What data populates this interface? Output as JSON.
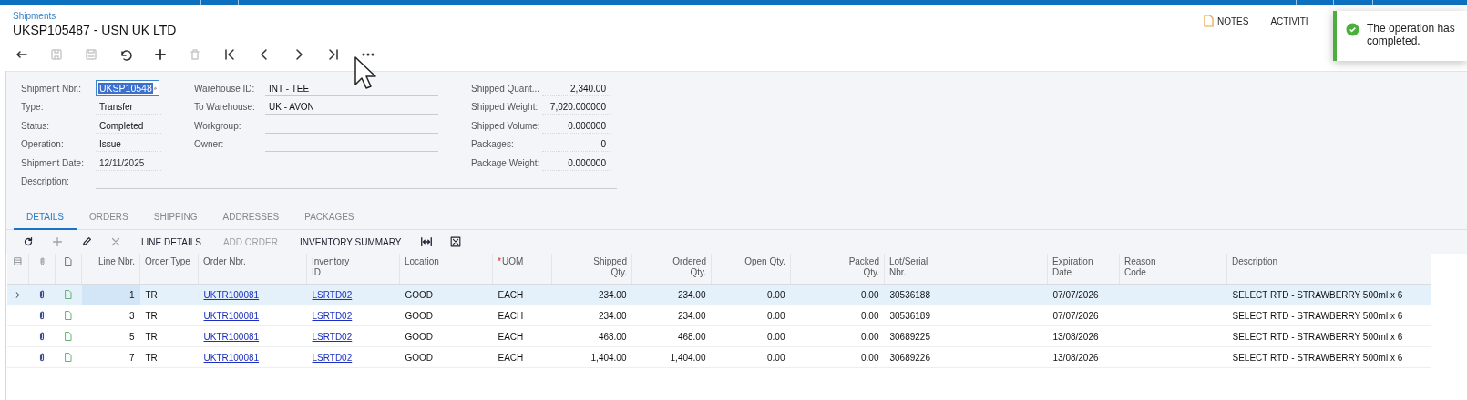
{
  "breadcrumb": "Shipments",
  "title": "UKSP105487 - USN UK LTD",
  "toolbar": [
    {
      "kind": "back",
      "disabled": false
    },
    {
      "kind": "save-close",
      "disabled": true
    },
    {
      "kind": "save",
      "disabled": true
    },
    {
      "kind": "undo",
      "disabled": false
    },
    {
      "kind": "add",
      "disabled": false
    },
    {
      "kind": "delete",
      "disabled": true
    },
    {
      "kind": "first",
      "disabled": false
    },
    {
      "kind": "prev",
      "disabled": false
    },
    {
      "kind": "next",
      "disabled": false
    },
    {
      "kind": "last",
      "disabled": false
    },
    {
      "kind": "more",
      "disabled": false
    }
  ],
  "header_links": [
    {
      "label": "NOTES",
      "kind": "note"
    },
    {
      "label": "ACTIVITI",
      "kind": "plain"
    }
  ],
  "toast": {
    "message": "The operation has completed.",
    "kind": "success"
  },
  "form": {
    "columns": [
      [
        {
          "label": "Shipment Nbr.:",
          "value": "UKSP10548",
          "kind": "search"
        },
        {
          "label": "Type:",
          "value": "Transfer",
          "kind": "text"
        },
        {
          "label": "Status:",
          "value": "Completed",
          "kind": "text"
        },
        {
          "label": "Operation:",
          "value": "Issue",
          "kind": "text"
        },
        {
          "label": "Shipment Date:",
          "value": "12/11/2025",
          "kind": "date"
        },
        {
          "label": "Description:",
          "kind": "wide"
        }
      ],
      [
        {
          "label": "Warehouse ID:",
          "value": "INT - TEE",
          "kind": "text"
        },
        {
          "label": "To Warehouse:",
          "value": "UK - AVON",
          "kind": "text"
        },
        {
          "label": "Workgroup:",
          "kind": "text"
        },
        {
          "label": "Owner:",
          "kind": "text"
        }
      ],
      [
        {
          "label": "Shipped Quant...",
          "value": "2,340.00",
          "kind": "number"
        },
        {
          "label": "Shipped Weight:",
          "value": "7,020.000000",
          "kind": "number"
        },
        {
          "label": "Shipped Volume:",
          "value": "0.000000",
          "kind": "number"
        },
        {
          "label": "Packages:",
          "value": "0",
          "kind": "number"
        },
        {
          "label": "Package Weight:",
          "value": "0.000000",
          "kind": "number"
        }
      ]
    ]
  },
  "tabs": [
    {
      "label": "DETAILS",
      "selected": true
    },
    {
      "label": "ORDERS",
      "selected": false
    },
    {
      "label": "SHIPPING",
      "selected": false
    },
    {
      "label": "ADDRESSES",
      "selected": false
    },
    {
      "label": "PACKAGES",
      "selected": false
    }
  ],
  "grid_toolbar": [
    {
      "kind": "refresh",
      "disabled": false
    },
    {
      "kind": "add",
      "disabled": true
    },
    {
      "kind": "edit",
      "disabled": false
    },
    {
      "kind": "delete",
      "disabled": true
    },
    {
      "kind": "text",
      "label": "LINE DETAILS",
      "disabled": false
    },
    {
      "kind": "text",
      "label": "ADD ORDER",
      "disabled": true
    },
    {
      "kind": "text",
      "label": "INVENTORY SUMMARY",
      "disabled": false
    },
    {
      "kind": "fit",
      "disabled": false
    },
    {
      "kind": "excel",
      "disabled": false
    }
  ],
  "grid": {
    "columns": [
      {
        "label": "Line Nbr.",
        "kind": "number"
      },
      {
        "label": "Order Type",
        "kind": "text"
      },
      {
        "label": "Order Nbr.",
        "kind": "link"
      },
      {
        "label": "Inventory ID",
        "kind": "link"
      },
      {
        "label": "Location",
        "kind": "text"
      },
      {
        "label": "UOM",
        "kind": "text",
        "required_mark": "*"
      },
      {
        "label": "Shipped Qty.",
        "kind": "number"
      },
      {
        "label": "Ordered Qty.",
        "kind": "number"
      },
      {
        "label": "Open Qty.",
        "kind": "number"
      },
      {
        "label": "Packed Qty.",
        "kind": "number"
      },
      {
        "label": "Lot/Serial Nbr.",
        "kind": "text"
      },
      {
        "label": "Expiration Date",
        "kind": "text"
      },
      {
        "label": "Reason Code",
        "kind": "text"
      },
      {
        "label": "Description",
        "kind": "text"
      }
    ],
    "rows": [
      {
        "selected": true,
        "cells": [
          "1",
          "TR",
          "UKTR100081",
          "LSRTD02",
          "GOOD",
          "EACH",
          "234.00",
          "234.00",
          "0.00",
          "0.00",
          "30536188",
          "07/07/2026",
          "",
          "SELECT RTD - STRAWBERRY 500ml x 6"
        ]
      },
      {
        "selected": false,
        "cells": [
          "3",
          "TR",
          "UKTR100081",
          "LSRTD02",
          "GOOD",
          "EACH",
          "234.00",
          "234.00",
          "0.00",
          "0.00",
          "30536189",
          "07/07/2026",
          "",
          "SELECT RTD - STRAWBERRY 500ml x 6"
        ]
      },
      {
        "selected": false,
        "cells": [
          "5",
          "TR",
          "UKTR100081",
          "LSRTD02",
          "GOOD",
          "EACH",
          "468.00",
          "468.00",
          "0.00",
          "0.00",
          "30689225",
          "13/08/2026",
          "",
          "SELECT RTD - STRAWBERRY 500ml x 6"
        ]
      },
      {
        "selected": false,
        "cells": [
          "7",
          "TR",
          "UKTR100081",
          "LSRTD02",
          "GOOD",
          "EACH",
          "1,404.00",
          "1,404.00",
          "0.00",
          "0.00",
          "30689226",
          "13/08/2026",
          "",
          "SELECT RTD - STRAWBERRY 500ml x 6"
        ]
      }
    ]
  }
}
